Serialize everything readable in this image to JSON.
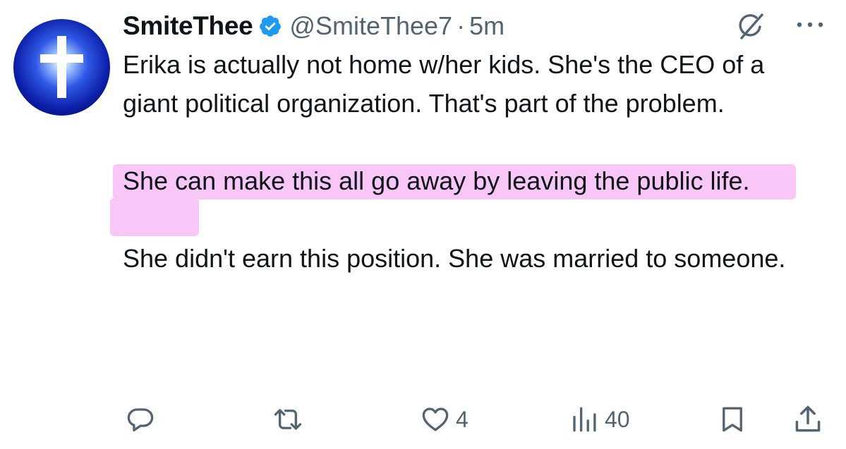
{
  "tweet": {
    "author": {
      "display_name": "SmiteThee",
      "handle": "@SmiteThee7",
      "verified": true,
      "avatar": "cross-avatar"
    },
    "separator": "·",
    "timestamp": "5m",
    "text": [
      "Erika is actually not home w/her kids. She's the CEO of a giant political organization. That's part of the problem.",
      "She can make this all go away by leaving the public life.",
      "She didn't earn this position. She was married to someone."
    ],
    "highlight_color": "#f8c7f8",
    "accent_color": "#1d9bf0"
  },
  "header_icons": {
    "grok": "grok-icon",
    "more": "more-icon"
  },
  "actions": {
    "reply": {
      "icon": "reply-icon"
    },
    "retweet": {
      "icon": "retweet-icon"
    },
    "like": {
      "icon": "heart-icon",
      "count": "4"
    },
    "views": {
      "icon": "views-icon",
      "count": "40"
    },
    "bookmark": {
      "icon": "bookmark-icon"
    },
    "share": {
      "icon": "share-icon"
    }
  }
}
